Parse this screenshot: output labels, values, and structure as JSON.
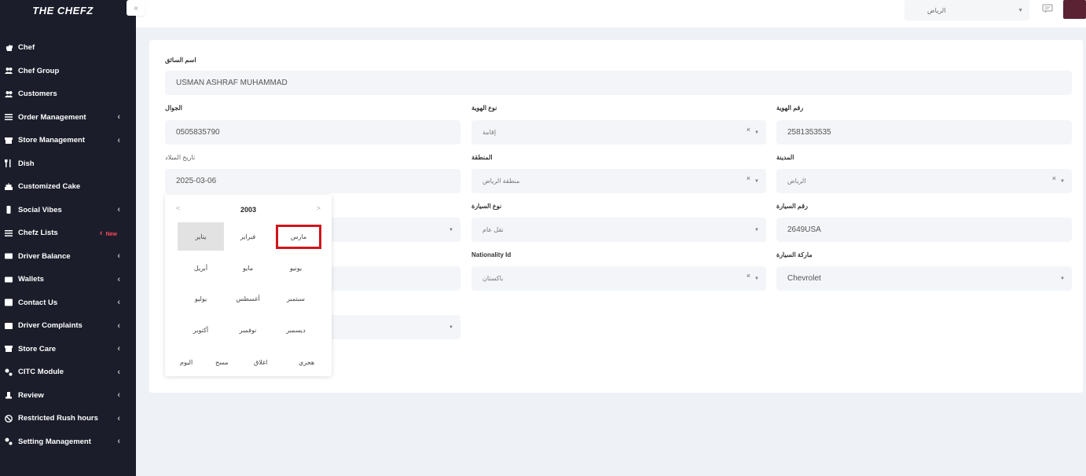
{
  "brand": "THE CHEFZ",
  "sidebar": {
    "items": [
      {
        "label": "Chef",
        "icon": "chef-hat-icon",
        "chevron": false
      },
      {
        "label": "Chef Group",
        "icon": "users-icon",
        "chevron": false
      },
      {
        "label": "Customers",
        "icon": "users-icon",
        "chevron": false
      },
      {
        "label": "Order Management",
        "icon": "list-icon",
        "chevron": true
      },
      {
        "label": "Store Management",
        "icon": "store-icon",
        "chevron": true
      },
      {
        "label": "Dish",
        "icon": "utensils-icon",
        "chevron": false
      },
      {
        "label": "Customized Cake",
        "icon": "cake-icon",
        "chevron": false
      },
      {
        "label": "Social Vibes",
        "icon": "phone-icon",
        "chevron": true
      },
      {
        "label": "Chefz Lists",
        "icon": "list-icon",
        "chevron": false,
        "badge": "New"
      },
      {
        "label": "Driver Balance",
        "icon": "wallet-icon",
        "chevron": true
      },
      {
        "label": "Wallets",
        "icon": "wallet-icon",
        "chevron": true
      },
      {
        "label": "Contact Us",
        "icon": "contact-icon",
        "chevron": true
      },
      {
        "label": "Driver Complaints",
        "icon": "complaint-icon",
        "chevron": true
      },
      {
        "label": "Store Care",
        "icon": "store-icon",
        "chevron": true
      },
      {
        "label": "CITC Module",
        "icon": "settings-icon",
        "chevron": true
      },
      {
        "label": "Review",
        "icon": "review-icon",
        "chevron": true
      },
      {
        "label": "Restricted Rush hours",
        "icon": "ban-icon",
        "chevron": true
      },
      {
        "label": "Setting Management",
        "icon": "settings-icon",
        "chevron": true
      }
    ]
  },
  "header": {
    "collapse": "«",
    "city_select": "الرياض"
  },
  "form": {
    "driver_name_label": "اسم السائق",
    "driver_name": "USMAN ASHRAF MUHAMMAD",
    "mobile_label": "الجوال",
    "mobile": "0505835790",
    "id_type_label": "نوع الهوية",
    "id_type": "إقامة",
    "id_number_label": "رقم الهوية",
    "id_number": "2581353535",
    "birth_date_label": "تاريخ الميلاد",
    "birth_date": "2025-03-06",
    "region_label": "المنطقة",
    "region": "منطقة الرياض",
    "city_label": "المدينة",
    "city": "الرياض",
    "car_type_label": "نوع السيارة",
    "car_type": "نقل عام",
    "car_number_label": "رقم السيارة",
    "car_number": "2649USA",
    "nationality_label": "Nationality Id",
    "nationality": "باكستان",
    "car_brand_label": "ماركة السيارة",
    "car_brand": "Chevrolet"
  },
  "picker": {
    "prev": "<",
    "next": ">",
    "year": "2003",
    "months": [
      "يناير",
      "فبراير",
      "مارس",
      "أبريل",
      "مايو",
      "يونيو",
      "يوليو",
      "أغسطس",
      "سبتمبر",
      "أكتوبر",
      "نوفمبر",
      "ديسمبر"
    ],
    "selected_month": "يناير",
    "highlighted_month": "مارس",
    "footer": [
      "اليوم",
      "مسح",
      "اغلاق",
      "هجري"
    ]
  }
}
